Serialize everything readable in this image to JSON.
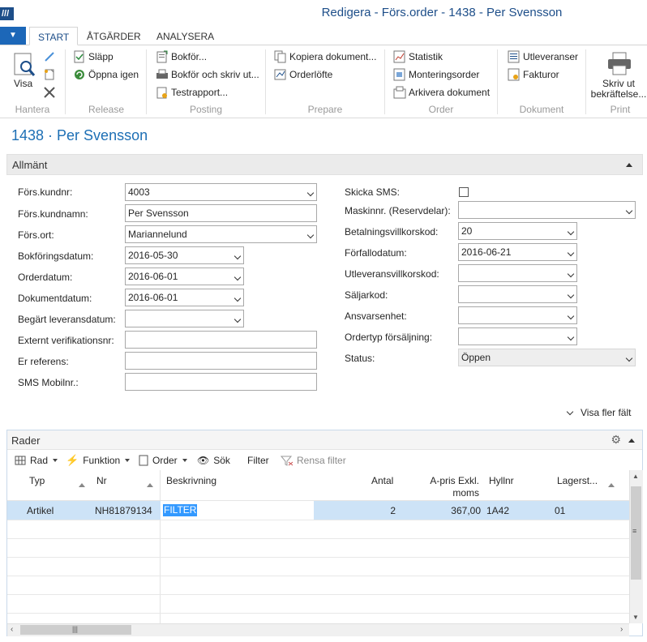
{
  "window": {
    "title": "Redigera - Förs.order - 1438 - Per Svensson",
    "logo_text": "/// "
  },
  "ribbon_tabs": [
    "START",
    "ÅTGÄRDER",
    "ANALYSERA"
  ],
  "ribbon": {
    "hantera": {
      "label": "Hantera",
      "visa": "Visa"
    },
    "release": {
      "label": "Release",
      "slapp": "Släpp",
      "oppna_igen": "Öppna igen"
    },
    "posting": {
      "label": "Posting",
      "bokfor": "Bokför...",
      "bokfor_skriv": "Bokför och skriv ut...",
      "testrapport": "Testrapport..."
    },
    "prepare": {
      "label": "Prepare",
      "kopiera": "Kopiera dokument...",
      "orderlofte": "Orderlöfte"
    },
    "order": {
      "label": "Order",
      "statistik": "Statistik",
      "monteringsorder": "Monteringsorder",
      "arkivera": "Arkivera dokument"
    },
    "dokument": {
      "label": "Dokument",
      "utleveranser": "Utleveranser",
      "fakturor": "Fakturor"
    },
    "print": {
      "label": "Print",
      "skriv_line1": "Skriv ut",
      "skriv_line2": "bekräftelse..."
    }
  },
  "page_title": "1438 · Per Svensson",
  "general_section": {
    "title": "Allmänt",
    "fields_left": [
      {
        "label": "Förs.kundnr:",
        "value": "4003"
      },
      {
        "label": "Förs.kundnamn:",
        "value": "Per Svensson"
      },
      {
        "label": "Förs.ort:",
        "value": "Mariannelund"
      },
      {
        "label": "Bokföringsdatum:",
        "value": "2016-05-30"
      },
      {
        "label": "Orderdatum:",
        "value": "2016-06-01"
      },
      {
        "label": "Dokumentdatum:",
        "value": "2016-06-01"
      },
      {
        "label": "Begärt leveransdatum:",
        "value": ""
      },
      {
        "label": "Externt verifikationsnr:",
        "value": ""
      },
      {
        "label": "Er referens:",
        "value": ""
      },
      {
        "label": "SMS Mobilnr.:",
        "value": ""
      }
    ],
    "fields_right": [
      {
        "label": "Skicka SMS:",
        "value": ""
      },
      {
        "label": "Maskinnr. (Reservdelar):",
        "value": ""
      },
      {
        "label": "Betalningsvillkorskod:",
        "value": "20"
      },
      {
        "label": "Förfallodatum:",
        "value": "2016-06-21"
      },
      {
        "label": "Utleveransvillkorskod:",
        "value": ""
      },
      {
        "label": "Säljarkod:",
        "value": ""
      },
      {
        "label": "Ansvarsenhet:",
        "value": ""
      },
      {
        "label": "Ordertyp försäljning:",
        "value": ""
      },
      {
        "label": "Status:",
        "value": "Öppen"
      }
    ],
    "show_more": "Visa fler fält"
  },
  "lines_section": {
    "title": "Rader",
    "toolbar": {
      "rad": "Rad",
      "funktion": "Funktion",
      "order": "Order",
      "sok": "Sök",
      "filter": "Filter",
      "rensa_filter": "Rensa filter"
    },
    "columns": {
      "typ": "Typ",
      "nr": "Nr",
      "beskrivning": "Beskrivning",
      "antal": "Antal",
      "apris_line1": "A-pris Exkl.",
      "apris_line2": "moms",
      "hyllnr": "Hyllnr",
      "lagerst": "Lagerst..."
    },
    "rows": [
      {
        "typ": "Artikel",
        "nr": "NH81879134",
        "beskrivning": "FILTER",
        "antal": "2",
        "apris": "367,00",
        "hyllnr": "1A42",
        "lagerst": "01"
      }
    ]
  },
  "colors": {
    "accent": "#1d6fb5",
    "app_menu": "#1c67b8",
    "selected_row": "#cde3f7"
  }
}
